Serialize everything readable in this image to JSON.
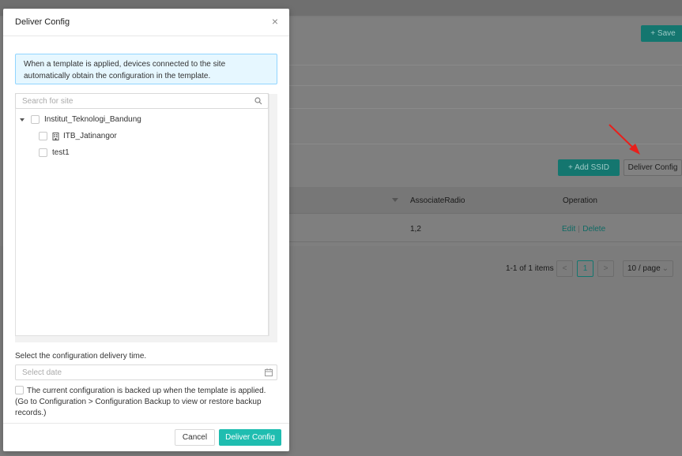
{
  "background": {
    "save_button": "+ Save",
    "add_ssid_button": "+ Add SSID",
    "deliver_config_button": "Deliver Config",
    "table": {
      "headers": [
        "AssociateRadio",
        "Operation"
      ],
      "rows": [
        {
          "associate_radio": "1,2",
          "edit": "Edit",
          "delete": "Delete"
        }
      ]
    },
    "pagination": {
      "summary": "1-1 of 1 items",
      "prev": "<",
      "current_page": "1",
      "next": ">",
      "page_size": "10 / page"
    },
    "accent_color": "#1fbdb0",
    "annotation_color": "#e8201c"
  },
  "modal": {
    "title": "Deliver Config",
    "close_glyph": "×",
    "info_text": "When a template is applied, devices connected to the site automatically obtain the configuration in the template.",
    "search_placeholder": "Search for site",
    "tree": {
      "root": {
        "label": "Institut_Teknologi_Bandung",
        "expanded": true,
        "checked": false
      },
      "children": [
        {
          "label": "ITB_Jatinangor",
          "icon": "building-icon",
          "checked": false
        },
        {
          "label": "test1",
          "checked": false
        }
      ]
    },
    "delivery_time_label": "Select the configuration delivery time.",
    "date_placeholder": "Select date",
    "backup_text": "The current configuration is backed up when the template is applied. (Go to Configuration > Configuration Backup to view or restore backup records.)",
    "backup_checked": false,
    "cancel_label": "Cancel",
    "deliver_label": "Deliver Config"
  }
}
